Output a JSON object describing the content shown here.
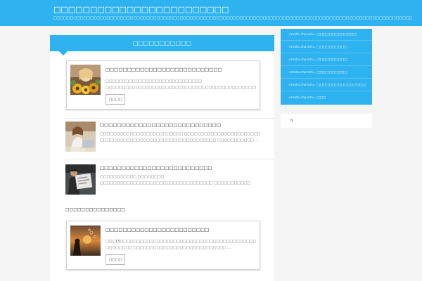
{
  "header": {
    "site_title": "□□□□□□□□□□□□□□□□□□□□□□□□",
    "site_description": "□□□□□□□□□□□□□□□□□□□□□□□□□□□□□□□□□□□□□□□□□□□□□□□□□□□□□□□□□□□□□□□□□□□□□□□□□□□□□□□□□□□□□□□□□□□□□□□□□□□□□□□□□□□□"
  },
  "main": {
    "section_title": "□□□□□□□□□□□",
    "posts": [
      {
        "title": "□□□□□□□□□□□□□□□□□□□□□□□□□□□",
        "excerpt": "□□□□□□□□□□□□□□□□□□□□□□□□□□□□□ □□□□□□□□□□□□□□□□□□□□□□□□□□□□□□□□□□□□□□□□□□□□□□ □□□□□□□□□□□□□□□□□□□□ ...",
        "more_label": "□□□□",
        "thumb_icon": "woman-with-flowers-photo"
      },
      {
        "title": "□□□□□□□□□□□□□□□□□□□□□□□□□□□□",
        "excerpt": "□□□□□□□□□□□□□□□□□□□□□□□□□ □□□□□□□□□□□□□□□□□□□□□□□ □□□□□□□□□□□□□□□□□□□□□□□□□□□□□□□□□□□ □□□□□□□□□□□ ...",
        "thumb_icon": "woman-at-laptop-photo"
      },
      {
        "title": "□□□□□□□□□□□□□□□□□□□□□□□□□□",
        "excerpt": "□□□□□□□□□□□ □□□□□□□□ □□□□□□□□□□□□□□□□□□□□□□□□□□□□□□□□□□ □□□□□□□□□□□ □□□□□□□□□□□□□□□□□□□□□□□ □□□□ ...",
        "thumb_icon": "man-reading-newspaper-photo"
      }
    ],
    "subsection_title": "□□□□□□□□□□□□□□□",
    "featured": {
      "title": "□□□□□□□□□□□□□□□□□□□□□□□□",
      "excerpt": "□□□15□□□□□□□□□□□□□□□□□□□□□□□□□□□□□□□□□□□□□□□□□□□□□□□□□□□□□□□□□□□□□□□□□□ □□□□□□□□ □□□□□□□□□□□□□□□□□□□□□□□□□□□□ ...",
      "more_label": "□□□□",
      "thumb_icon": "sunset-bubbles-photo"
    }
  },
  "sidebar": {
    "items": [
      {
        "prefix": "<meta charset=",
        "label": "□□□□□□□□□□□□□"
      },
      {
        "prefix": "<meta charset=",
        "label": "□□□□□□□□□□"
      },
      {
        "prefix": "<meta charset=",
        "label": "□□□□□□□□□□"
      },
      {
        "prefix": "<meta charset=",
        "label": "□□□□□□□□□□"
      },
      {
        "prefix": "<meta charset=",
        "label": "□□□□□□□□□□□□□□□□"
      },
      {
        "prefix": "<meta charset=",
        "label": "□□□"
      }
    ],
    "box_text": "N"
  },
  "colors": {
    "accent": "#2eb3f0",
    "page_bg": "#f5f5f5"
  }
}
